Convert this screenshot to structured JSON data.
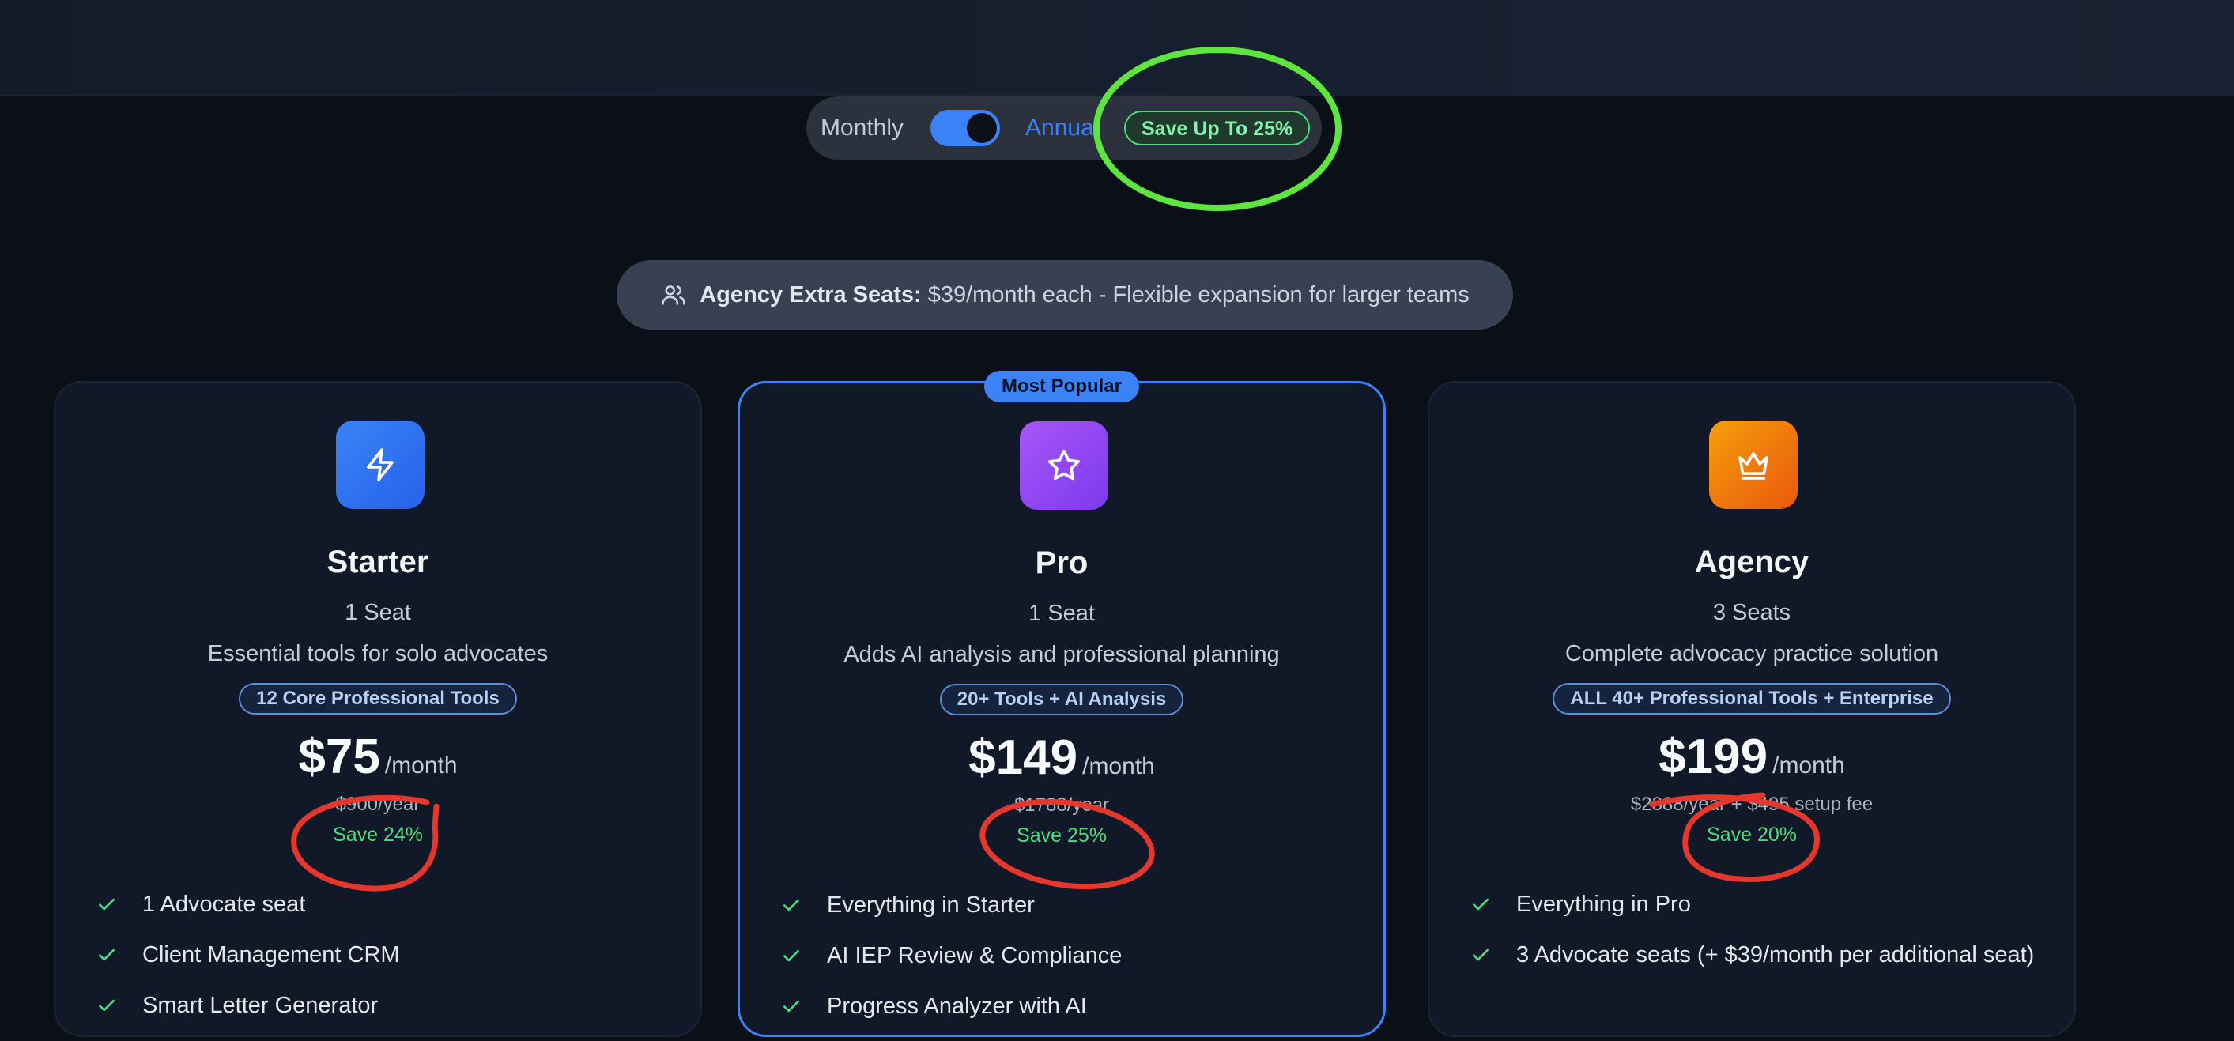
{
  "billing": {
    "monthly_label": "Monthly",
    "annual_label": "Annual",
    "annual_selected": true,
    "save_badge": "Save Up To 25%"
  },
  "banner": {
    "icon": "users-icon",
    "bold": "Agency Extra Seats:",
    "text": " $39/month each - Flexible expansion for larger teams"
  },
  "plans": [
    {
      "icon": "lightning-icon",
      "name": "Starter",
      "seats": "1 Seat",
      "description": "Essential tools for solo advocates",
      "tools_badge": "12 Core Professional Tools",
      "price": "$75",
      "per": "/month",
      "yearly": "$900/year",
      "save": "Save 24%",
      "features": [
        "1 Advocate seat",
        "Client Management CRM",
        "Smart Letter Generator"
      ]
    },
    {
      "icon": "star-icon",
      "name": "Pro",
      "badge": "Most Popular",
      "seats": "1 Seat",
      "description": "Adds AI analysis and professional planning",
      "tools_badge": "20+ Tools + AI Analysis",
      "price": "$149",
      "per": "/month",
      "yearly": "$1788/year",
      "save": "Save 25%",
      "features": [
        "Everything in Starter",
        "AI IEP Review & Compliance",
        "Progress Analyzer with AI"
      ]
    },
    {
      "icon": "crown-icon",
      "name": "Agency",
      "seats": "3 Seats",
      "description": "Complete advocacy practice solution",
      "tools_badge": "ALL 40+ Professional Tools + Enterprise",
      "price": "$199",
      "per": "/month",
      "yearly": "$2388/year + $495 setup fee",
      "save": "Save 20%",
      "features": [
        "Everything in Pro",
        "3 Advocate seats (+ $39/month per additional seat)"
      ]
    }
  ],
  "colors": {
    "accent": "#3b82f6",
    "success": "#4ade80",
    "annotation_green": "#5ee53f",
    "annotation_red": "#e5372b"
  }
}
